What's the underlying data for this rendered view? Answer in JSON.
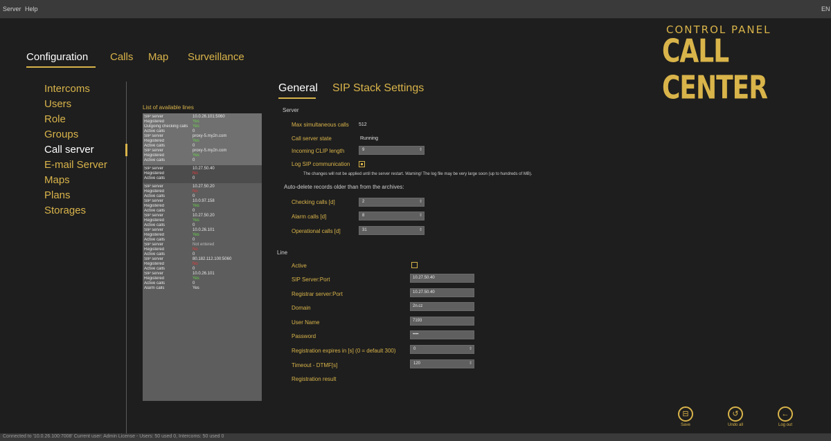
{
  "menu": {
    "server": "Server",
    "help": "Help",
    "right": "EN"
  },
  "brand": {
    "top": "CONTROL PANEL",
    "main": "CALL CENTER"
  },
  "nav": {
    "tabs": [
      "Configuration",
      "Calls",
      "Map",
      "Surveillance"
    ],
    "active": 0
  },
  "sidebar": {
    "items": [
      "Intercoms",
      "Users",
      "Role",
      "Groups",
      "Call server",
      "E-mail Server",
      "Maps",
      "Plans",
      "Storages"
    ],
    "active": 4
  },
  "lines": {
    "title": "List of available lines",
    "groups": [
      {
        "style": "sel",
        "rows": [
          [
            "SIP server",
            "10.0.26.101:5060",
            ""
          ],
          [
            "Registered",
            "Yes",
            "yes"
          ],
          [
            "Outgoing checking calls",
            "Yes",
            "yes"
          ],
          [
            "Active calls",
            "0",
            ""
          ],
          [
            "SIP server",
            "proxy-5.my2n.com",
            ""
          ],
          [
            "Registered",
            "Yes",
            "yes"
          ],
          [
            "Active calls",
            "0",
            ""
          ],
          [
            "SIP server",
            "proxy-5.my2n.com",
            ""
          ],
          [
            "Registered",
            "Yes",
            "yes"
          ],
          [
            "Active calls",
            "0",
            ""
          ]
        ]
      },
      {
        "style": "dark",
        "rows": [
          [
            "SIP server",
            "10.27.50.40",
            ""
          ],
          [
            "Registered",
            "No",
            "no"
          ],
          [
            "Active calls",
            "0",
            ""
          ]
        ]
      },
      {
        "style": "plain",
        "rows": [
          [
            "SIP server",
            "10.27.50.20",
            ""
          ],
          [
            "Registered",
            "No",
            "no"
          ],
          [
            "Active calls",
            "0",
            ""
          ],
          [
            "SIP server",
            "10.0.97.158",
            ""
          ],
          [
            "Registered",
            "Yes",
            "yes"
          ],
          [
            "Active calls",
            "0",
            ""
          ],
          [
            "SIP server",
            "10.27.50.20",
            ""
          ],
          [
            "Registered",
            "Yes",
            "yes"
          ],
          [
            "Active calls",
            "0",
            ""
          ],
          [
            "SIP server",
            "10.0.26.101",
            ""
          ],
          [
            "Registered",
            "Yes",
            "yes"
          ],
          [
            "Active calls",
            "0",
            ""
          ],
          [
            "SIP server",
            "Not entered",
            "gray"
          ],
          [
            "Registered",
            "No",
            "no"
          ],
          [
            "Active calls",
            "0",
            ""
          ],
          [
            "SIP server",
            "80.182.112.100:5060",
            ""
          ],
          [
            "Registered",
            "No",
            "no"
          ],
          [
            "Active calls",
            "0",
            ""
          ],
          [
            "SIP server",
            "10.0.26.101",
            ""
          ],
          [
            "Registered",
            "Yes",
            "yes"
          ],
          [
            "Active calls",
            "0",
            ""
          ],
          [
            "Alarm calls",
            "Yes",
            ""
          ]
        ]
      }
    ]
  },
  "subtabs": [
    "General",
    "SIP Stack Settings"
  ],
  "server": {
    "section": "Server",
    "max_calls_label": "Max simultaneous calls",
    "max_calls_value": "512",
    "state_label": "Call server state",
    "state_value": "Running",
    "clip_label": "Incoming CLIP length",
    "clip_value": "9",
    "log_label": "Log SIP communication",
    "log_checked": true,
    "note": "The changes will not be applied until the server restart. Warning! The log file may be very large soon (up to hundreds of MB).",
    "autodelete": "Auto-delete records older than from the archives:",
    "checking_label": "Checking calls [d]",
    "checking_value": "2",
    "alarm_label": "Alarm calls [d]",
    "alarm_value": "8",
    "operational_label": "Operational calls [d]",
    "operational_value": "31"
  },
  "line": {
    "section": "Line",
    "active_label": "Active",
    "active_checked": false,
    "sip_port_label": "SIP Server:Port",
    "sip_port_value": "10.27.50.40",
    "reg_port_label": "Registrar server:Port",
    "reg_port_value": "10.27.50.40",
    "domain_label": "Domain",
    "domain_value": "2n.cz",
    "user_label": "User Name",
    "user_value": "7193",
    "password_label": "Password",
    "password_value": "••••",
    "reg_expires_label": "Registration expires in [s] (0 = default 300)",
    "reg_expires_value": "0",
    "dtmf_label": "Timeout - DTMF[s]",
    "dtmf_value": "120",
    "reg_result_label": "Registration result"
  },
  "actions": {
    "save": "Save",
    "undo": "Undo all",
    "logout": "Log out"
  },
  "status": "Connected to '10.0.26.100:7008'  Current user: Admin   License - Users: 50 used 0, Intercoms: 50 used 0"
}
